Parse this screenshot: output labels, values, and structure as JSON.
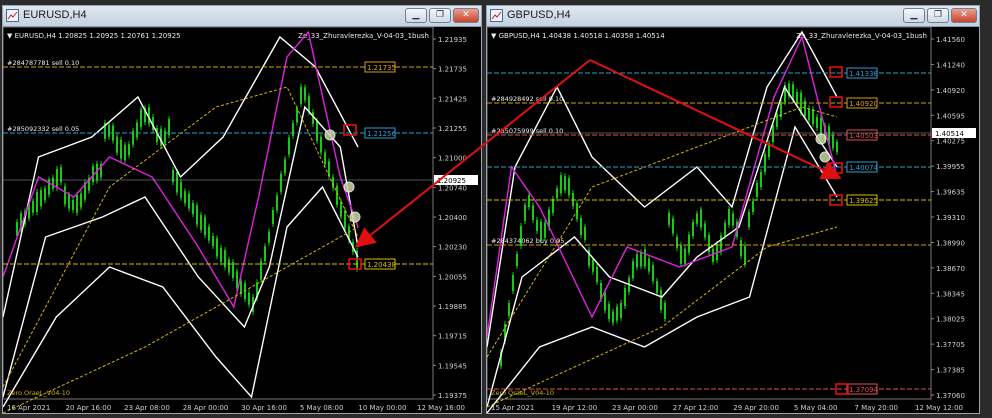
{
  "left": {
    "title": "EURUSD,H4",
    "header": "▼ EURUSD,H4  1.20825 1.20925 1.20761 1.20925",
    "indicator": "Ze_33_Zhuravlerezka_V-04-03_1bush",
    "current_price": "1.20925",
    "price_axis": [
      "1.21935",
      "1.21735",
      "1.21425",
      "1.21255",
      "1.21000",
      "1.20740",
      "1.20400",
      "1.20230",
      "1.20055",
      "1.19885",
      "1.19715",
      "1.19545",
      "1.19375"
    ],
    "time_axis": [
      "16 Apr 2021",
      "20 Apr 16:00",
      "23 Apr 08:00",
      "28 Apr 00:00",
      "30 Apr 16:00",
      "5 May 08:00",
      "10 May 00:00",
      "12 May 16:00"
    ],
    "levels": [
      {
        "note": "#284787781 sell 0.10",
        "box": "1.21735",
        "color": "#d4a017"
      },
      {
        "note": "#285092332 sell 0.05",
        "box": "1.21256",
        "color": "#2a9fd0"
      },
      {
        "note": "",
        "box": "1.20438",
        "color": "#d4c000"
      }
    ],
    "footer": "Zero OraeL_V04-10"
  },
  "right": {
    "title": "GBPUSD,H4",
    "header": "▼ GBPUSD,H4  1.40438 1.40518 1.40358 1.40514",
    "indicator": "Ze_33_Zhuravlerezka_V-04-03_1bush",
    "current_price": "1.40514",
    "price_axis": [
      "1.41560",
      "1.41240",
      "1.40920",
      "1.40595",
      "1.40275",
      "1.39955",
      "1.39635",
      "1.39310",
      "1.38990",
      "1.38670",
      "1.38345",
      "1.38025",
      "1.37705",
      "1.37385",
      "1.37060"
    ],
    "time_axis": [
      "15 Apr 2021",
      "19 Apr 12:00",
      "23 Apr 00:00",
      "27 Apr 12:00",
      "29 Apr 20:00",
      "5 May 04:00",
      "7 May 20:00",
      "12 May 12:00"
    ],
    "levels": [
      {
        "note": "",
        "box": "1.41338",
        "color": "#2a9fd0"
      },
      {
        "note": "#284928492 sell 0.10",
        "box": "1.40920",
        "color": "#d4a017"
      },
      {
        "note": "#285075999 sell 0.10",
        "box": "1.40503",
        "color": "#e05050"
      },
      {
        "note": "",
        "box": "1.40074",
        "color": "#2a9fd0"
      },
      {
        "note": "",
        "box": "1.39625",
        "color": "#d4c000"
      },
      {
        "note": "#284374062 buy 0.05",
        "box": "",
        "color": "#d4a017"
      },
      {
        "note": "",
        "box": "1.37094",
        "color": "#e05050"
      }
    ],
    "footer": "Zero OraeL_V04-10"
  },
  "colors": {
    "candle_up": "#19c819",
    "bands": "#ffffff",
    "ma": "#e020e0",
    "trend": "#d4b400",
    "arrow": "#e01010"
  }
}
